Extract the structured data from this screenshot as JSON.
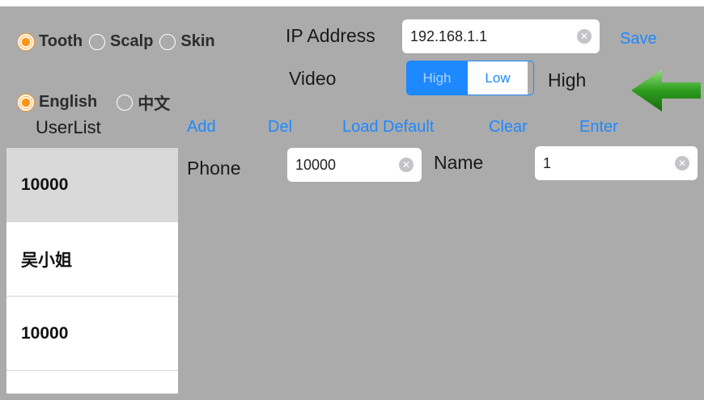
{
  "mode_options": [
    {
      "label": "Tooth",
      "selected": true
    },
    {
      "label": "Scalp",
      "selected": false
    },
    {
      "label": "Skin",
      "selected": false
    }
  ],
  "language_options": [
    {
      "label": "English",
      "selected": true
    },
    {
      "label": "中文",
      "selected": false
    }
  ],
  "ip": {
    "label": "IP Address",
    "value": "192.168.1.1",
    "save_label": "Save"
  },
  "video": {
    "label": "Video",
    "options": [
      "High",
      "Low"
    ],
    "selected": "High",
    "current_value": "High"
  },
  "userlist": {
    "title": "UserList",
    "actions": [
      "Add",
      "Del",
      "Load Default",
      "Clear",
      "Enter"
    ],
    "items": [
      "10000",
      "吴小姐",
      "10000"
    ],
    "selected_index": 0
  },
  "detail": {
    "phone_label": "Phone",
    "phone_value": "10000",
    "name_label": "Name",
    "name_value": "1"
  },
  "colors": {
    "accent": "#1e88ff",
    "radio": "#ff9517",
    "arrow": "#2e9d1e",
    "background": "#ababab"
  },
  "icons": {
    "clear": "clear-icon",
    "arrow": "left-arrow-icon"
  }
}
